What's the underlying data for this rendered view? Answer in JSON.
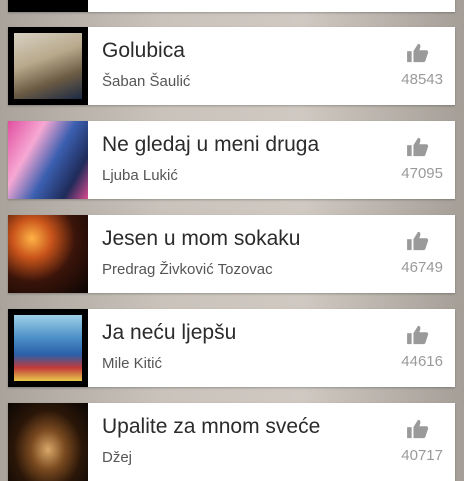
{
  "songs": [
    {
      "title": "Golubica",
      "artist": "Šaban Šaulić",
      "likes": "48543"
    },
    {
      "title": "Ne gledaj u meni druga",
      "artist": "Ljuba Lukić",
      "likes": "47095"
    },
    {
      "title": "Jesen u mom sokaku",
      "artist": "Predrag Živković Tozovac",
      "likes": "46749"
    },
    {
      "title": "Ja neću lјepšu",
      "artist": "Mile Kitić",
      "likes": "44616"
    },
    {
      "title": "Upalite za mnom sveće",
      "artist": "Džej",
      "likes": "40717"
    }
  ],
  "icons": {
    "like": "thumbs-up-icon"
  },
  "colors": {
    "title": "#2b2b2b",
    "artist": "#555555",
    "count": "#9a9a9a",
    "icon": "#9a9a9a"
  }
}
